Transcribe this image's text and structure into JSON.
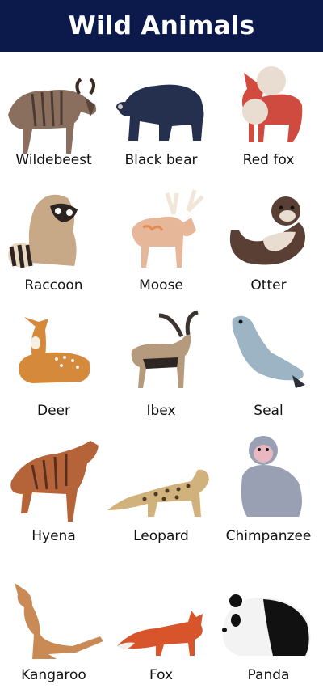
{
  "title": "Wild Animals",
  "animals": [
    {
      "name": "Wildebeest",
      "icon": "wildebeest-icon"
    },
    {
      "name": "Black bear",
      "icon": "black-bear-icon"
    },
    {
      "name": "Red fox",
      "icon": "red-fox-icon"
    },
    {
      "name": "Raccoon",
      "icon": "raccoon-icon"
    },
    {
      "name": "Moose",
      "icon": "moose-icon"
    },
    {
      "name": "Otter",
      "icon": "otter-icon"
    },
    {
      "name": "Deer",
      "icon": "deer-icon"
    },
    {
      "name": "Ibex",
      "icon": "ibex-icon"
    },
    {
      "name": "Seal",
      "icon": "seal-icon"
    },
    {
      "name": "Hyena",
      "icon": "hyena-icon"
    },
    {
      "name": "Leopard",
      "icon": "leopard-icon"
    },
    {
      "name": "Chimpanzee",
      "icon": "chimpanzee-icon"
    },
    {
      "name": "Kangaroo",
      "icon": "kangaroo-icon"
    },
    {
      "name": "Fox",
      "icon": "fox-icon"
    },
    {
      "name": "Panda",
      "icon": "panda-icon"
    }
  ],
  "colors": {
    "header_bg": "#0b1a4a",
    "header_text": "#ffffff",
    "label_text": "#111111"
  }
}
